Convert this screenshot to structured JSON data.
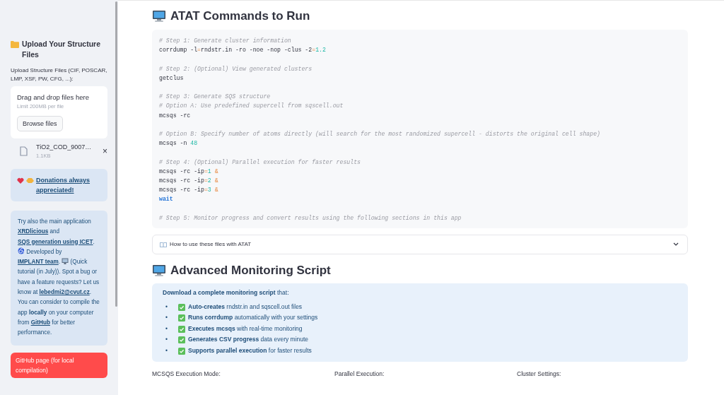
{
  "sidebar": {
    "upload_heading": "Upload Your Structure Files",
    "upload_label": "Upload Structure Files (CIF, POSCAR, LMP, XSF, PW, CFG, ...):",
    "dropzone": {
      "title": "Drag and drop files here",
      "limit": "Limit 200MB per file",
      "button": "Browse files"
    },
    "files": [
      {
        "name": "TiO2_COD_9007…",
        "size": "1.1KB",
        "remove": "×"
      }
    ],
    "donation": {
      "link": "Donations always appreciated!"
    },
    "info": [
      {
        "kind": "text",
        "text": "Try also the main application "
      },
      {
        "kind": "link",
        "text": "XRDlicious"
      },
      {
        "kind": "text",
        "text": " and "
      },
      {
        "kind": "link",
        "text": "SQS generation using ICET"
      },
      {
        "kind": "text",
        "text": ". "
      },
      {
        "kind": "icon"
      },
      {
        "kind": "text",
        "text": " Developed by "
      },
      {
        "kind": "link",
        "text": "IMPLANT team"
      },
      {
        "kind": "text",
        "text": ". "
      },
      {
        "kind": "icon"
      },
      {
        "kind": "text",
        "text": " (Quick tutorial (in July)). Spot a bug or have a feature requests? Let us know at "
      },
      {
        "kind": "link",
        "text": "lebedmi2@cvut.cz"
      },
      {
        "kind": "text",
        "text": ". You can consider to compile the app "
      },
      {
        "kind": "bold",
        "text": "locally"
      },
      {
        "kind": "text",
        "text": " on your computer from "
      },
      {
        "kind": "link",
        "text": "GitHub"
      },
      {
        "kind": "text",
        "text": " for better performance."
      }
    ],
    "github_button": "GitHub page (for local compilation)"
  },
  "main": {
    "commands_heading": "ATAT Commands to Run",
    "code_groups": [
      [
        [
          {
            "kind": "comment",
            "text": "# Step 1: Generate cluster information"
          }
        ],
        [
          {
            "kind": "plain",
            "text": "corrdump -l"
          },
          {
            "kind": "operator",
            "text": "="
          },
          {
            "kind": "plain",
            "text": "rndstr.in -ro -noe -nop -clus -2"
          },
          {
            "kind": "operator",
            "text": "="
          },
          {
            "kind": "number",
            "text": "1.2"
          }
        ]
      ],
      [
        [
          {
            "kind": "comment",
            "text": "# Step 2: (Optional) View generated clusters"
          }
        ],
        [
          {
            "kind": "plain",
            "text": "getclus"
          }
        ]
      ],
      [
        [
          {
            "kind": "comment",
            "text": "# Step 3: Generate SQS structure"
          }
        ],
        [
          {
            "kind": "comment",
            "text": "# Option A: Use predefined supercell from sqscell.out"
          }
        ],
        [
          {
            "kind": "plain",
            "text": "mcsqs -rc"
          }
        ]
      ],
      [
        [
          {
            "kind": "comment",
            "text": "# Option B: Specify number of atoms directly (will search for the most randomized supercell - distorts the original cell shape)"
          }
        ],
        [
          {
            "kind": "plain",
            "text": "mcsqs -n "
          },
          {
            "kind": "number",
            "text": "48"
          }
        ]
      ],
      [
        [
          {
            "kind": "comment",
            "text": "# Step 4: (Optional) Parallel execution for faster results"
          }
        ],
        [
          {
            "kind": "plain",
            "text": "mcsqs -rc -ip"
          },
          {
            "kind": "operator",
            "text": "="
          },
          {
            "kind": "number",
            "text": "1"
          },
          {
            "kind": "amp",
            "text": " &"
          }
        ],
        [
          {
            "kind": "plain",
            "text": "mcsqs -rc -ip"
          },
          {
            "kind": "operator",
            "text": "="
          },
          {
            "kind": "number",
            "text": "2"
          },
          {
            "kind": "amp",
            "text": " &"
          }
        ],
        [
          {
            "kind": "plain",
            "text": "mcsqs -rc -ip"
          },
          {
            "kind": "operator",
            "text": "="
          },
          {
            "kind": "number",
            "text": "3"
          },
          {
            "kind": "amp",
            "text": " &"
          }
        ],
        [
          {
            "kind": "keyword",
            "text": "wait"
          }
        ]
      ],
      [
        [
          {
            "kind": "comment",
            "text": "# Step 5: Monitor progress and convert results using the following sections in this app"
          }
        ]
      ]
    ],
    "expander": {
      "label": "How to use these files with ATAT",
      "expanded": false
    },
    "monitoring_heading": "Advanced Monitoring Script",
    "monitoring_info": {
      "intro": "**Download a complete monitoring script** that:",
      "items": [
        {
          "bullet": "•",
          "text": "**Auto-creates** rndstr.in and sqscell.out files"
        },
        {
          "bullet": "•",
          "text": "**Runs corrdump** automatically with your settings"
        },
        {
          "bullet": "•",
          "text": "**Executes mcsqs** with real-time monitoring"
        },
        {
          "bullet": "•",
          "text": "**Generates CSV progress** data every minute"
        },
        {
          "bullet": "•",
          "text": "**Supports parallel execution** for faster results"
        }
      ]
    },
    "settings_labels": [
      "MCSQS Execution Mode:",
      "Parallel Execution:",
      "Cluster Settings:"
    ]
  }
}
